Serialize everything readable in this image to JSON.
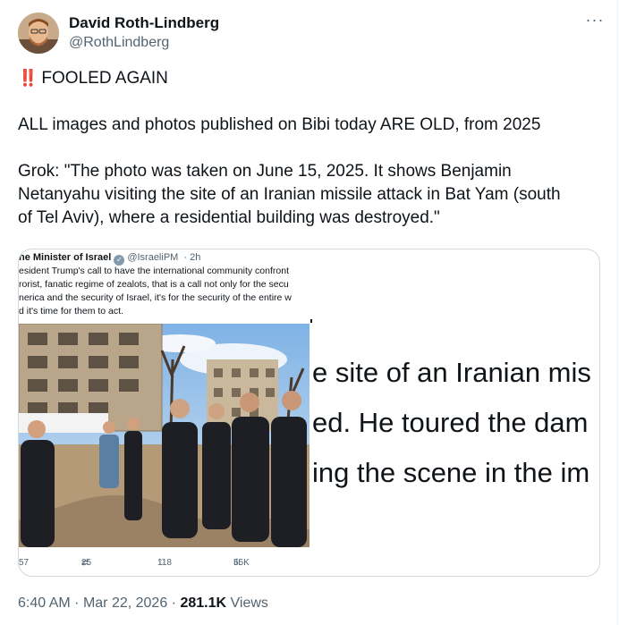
{
  "author": {
    "display_name": "David Roth-Lindberg",
    "handle": "@RothLindberg",
    "avatar_icon": "avatar-photo"
  },
  "more_label": "···",
  "tweet": {
    "bang": "‼️",
    "line1": "FOOLED AGAIN",
    "line2": "ALL images and photos published on Bibi today ARE OLD, from 2025",
    "line3": "Grok: \"The photo was taken on June 15, 2025. It shows Benjamin\nNetanyahu visiting the site of an Iranian missile attack in Bat Yam (south\nof Tel Aviv), where a residential building was destroyed.\""
  },
  "embedded": {
    "name": "ne Minister of Israel",
    "verified_icon": "verified-badge-icon",
    "handle": "@IsraeliPM",
    "time": "· 2h",
    "text_lines": [
      "esident Trump's call to have the international community confront",
      "rorist, fanatic regime of zealots, that is a call not only for the secu",
      "nerica and the security of Israel, it's for the security of the entire w",
      "d it's time for them to act."
    ],
    "actions": {
      "replies": "57",
      "reposts": "25",
      "likes": "118",
      "views": "55K"
    }
  },
  "overlay_lines": [
    "e site of an Iranian mis",
    "ed. He toured the dam",
    "ing the scene in the im"
  ],
  "footer": {
    "time": "6:40 AM",
    "date": "Mar 22, 2026",
    "views_count": "281.1K",
    "views_label": "Views"
  },
  "colors": {
    "text": "#0f1419",
    "secondary": "#536471",
    "border": "#cfd9de",
    "bang": "#e0245e"
  }
}
